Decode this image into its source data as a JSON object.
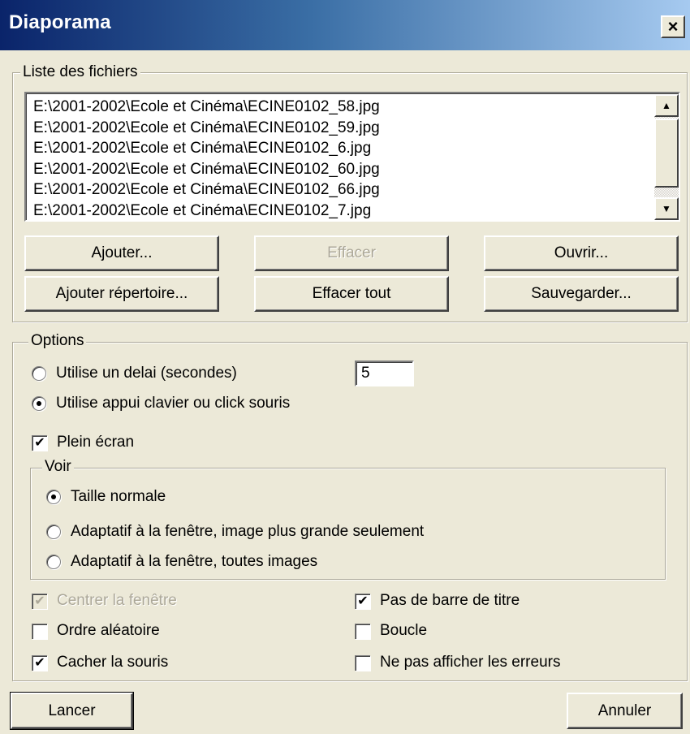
{
  "window": {
    "title": "Diaporama",
    "close_glyph": "×"
  },
  "files_group": {
    "legend": "Liste des fichiers",
    "files": [
      "E:\\2001-2002\\Ecole et Cinéma\\ECINE0102_58.jpg",
      "E:\\2001-2002\\Ecole et Cinéma\\ECINE0102_59.jpg",
      "E:\\2001-2002\\Ecole et Cinéma\\ECINE0102_6.jpg",
      "E:\\2001-2002\\Ecole et Cinéma\\ECINE0102_60.jpg",
      "E:\\2001-2002\\Ecole et Cinéma\\ECINE0102_66.jpg",
      "E:\\2001-2002\\Ecole et Cinéma\\ECINE0102_7.jpg"
    ],
    "scroll_up_glyph": "▲",
    "scroll_down_glyph": "▼",
    "buttons": {
      "add": "Ajouter...",
      "delete": "Effacer",
      "open": "Ouvrir...",
      "add_dir": "Ajouter répertoire...",
      "delete_all": "Effacer tout",
      "save": "Sauvegarder..."
    }
  },
  "options_group": {
    "legend": "Options",
    "use_delay": {
      "label": "Utilise un delai (secondes)",
      "selected": false
    },
    "delay_value": "5",
    "use_key": {
      "label": "Utilise appui clavier ou click souris",
      "selected": true
    },
    "fullscreen": {
      "label": "Plein écran",
      "checked": true
    },
    "view_group": {
      "legend": "Voir",
      "normal": {
        "label": "Taille normale",
        "selected": true
      },
      "fit_larger": {
        "label": "Adaptatif à la fenêtre, image plus grande seulement",
        "selected": false
      },
      "fit_all": {
        "label": "Adaptatif à la fenêtre, toutes images",
        "selected": false
      }
    },
    "center_window": {
      "label": "Centrer la fenêtre",
      "checked": true,
      "disabled": true
    },
    "no_titlebar": {
      "label": "Pas de barre de titre",
      "checked": true
    },
    "random_order": {
      "label": "Ordre aléatoire",
      "checked": false
    },
    "loop": {
      "label": "Boucle",
      "checked": false
    },
    "hide_mouse": {
      "label": "Cacher la souris",
      "checked": true
    },
    "hide_errors": {
      "label": "Ne pas afficher les erreurs",
      "checked": false
    }
  },
  "footer": {
    "launch": "Lancer",
    "cancel": "Annuler"
  },
  "check_glyph": "✔"
}
